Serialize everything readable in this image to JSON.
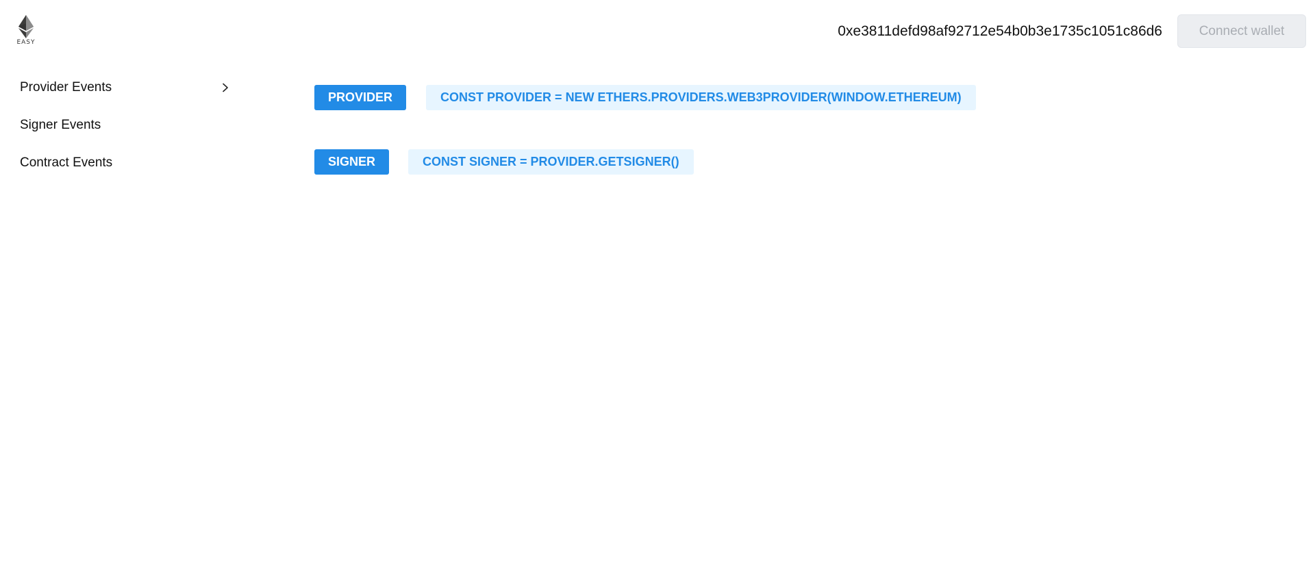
{
  "header": {
    "logo": {
      "icon": "ethereum-icon",
      "text": "EASY"
    },
    "address": "0xe3811defd98af92712e54b0b3e1735c1051c86d6",
    "connect_label": "Connect wallet"
  },
  "sidebar": {
    "items": [
      {
        "label": "Provider Events",
        "icon": "chevron-right-icon"
      },
      {
        "label": "Signer Events"
      },
      {
        "label": "Contract Events"
      }
    ]
  },
  "main": {
    "rows": [
      {
        "button_label": "PROVIDER",
        "code": "CONST PROVIDER = NEW ETHERS.PROVIDERS.WEB3PROVIDER(WINDOW.ETHEREUM)"
      },
      {
        "button_label": "SIGNER",
        "code": "CONST SIGNER = PROVIDER.GETSIGNER()"
      }
    ]
  },
  "colors": {
    "primary": "#228be6",
    "code_bg": "#e7f5ff",
    "disabled_bg": "#eceef1",
    "disabled_text": "#a9adb3"
  }
}
